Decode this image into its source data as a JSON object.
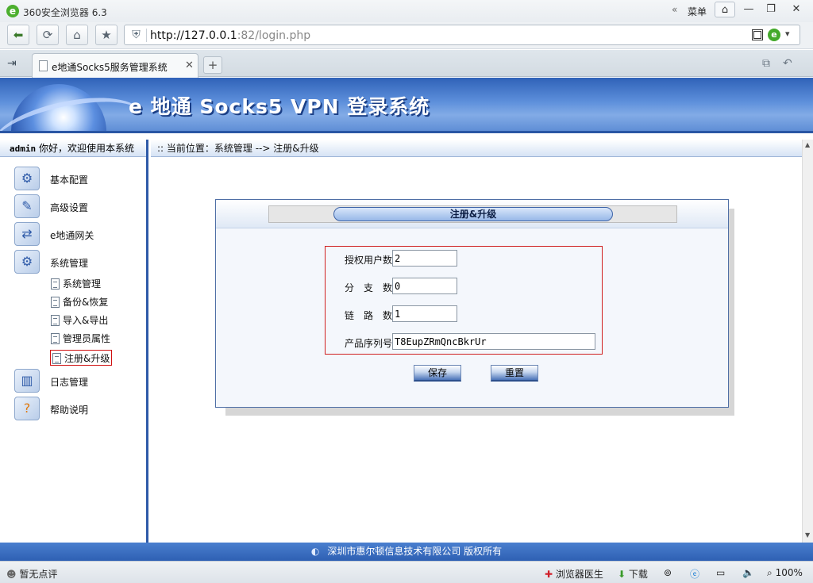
{
  "browser": {
    "window_title": "360安全浏览器 6.3",
    "menu_label": "菜单",
    "url_host": "http://127.0.0.1",
    "url_rest": ":82/login.php",
    "tab_title": "e地通Socks5服务管理系统",
    "new_tab": "+"
  },
  "app": {
    "banner_title": "e 地通 Socks5 VPN 登录系统",
    "user": "admin",
    "welcome": " 你好，欢迎使用本系统",
    "breadcrumb": ":: 当前位置：系统管理 --> 注册&升级"
  },
  "sidebar": {
    "items": [
      {
        "label": "基本配置",
        "icon": "settings-icon"
      },
      {
        "label": "高级设置",
        "icon": "advanced-settings-icon"
      },
      {
        "label": "e地通网关",
        "icon": "gateway-icon"
      },
      {
        "label": "系统管理",
        "icon": "system-management-icon"
      },
      {
        "label": "日志管理",
        "icon": "log-icon"
      },
      {
        "label": "帮助说明",
        "icon": "help-icon"
      }
    ],
    "subitems": [
      {
        "label": "系统管理"
      },
      {
        "label": "备份&恢复"
      },
      {
        "label": "导入&导出"
      },
      {
        "label": "管理员属性"
      },
      {
        "label": "注册&升级"
      }
    ]
  },
  "panel": {
    "title": "注册&升级",
    "fields": [
      {
        "label": "授权用户数",
        "value": "2"
      },
      {
        "label": "分　支　数",
        "value": "0"
      },
      {
        "label": "链　路　数",
        "value": "1"
      },
      {
        "label": "产品序列号",
        "value": "T8EupZRmQncBkrUr"
      }
    ],
    "save_button": "保存",
    "reset_button": "重置"
  },
  "footer": {
    "copyright": "深圳市惠尔顿信息技术有限公司 版权所有"
  },
  "statusbar": {
    "comment": "暂无点评",
    "doctor": "浏览器医生",
    "download": "下载",
    "zoom": "100%"
  },
  "colors": {
    "brand_blue": "#2e5aa8",
    "highlight_red": "#d01010"
  }
}
